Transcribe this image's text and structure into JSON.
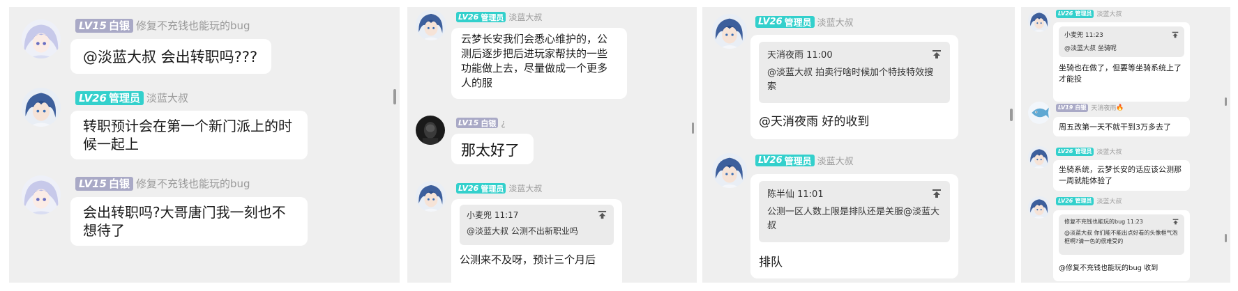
{
  "panels": {
    "p1": {
      "messages": [
        {
          "level": "LV15",
          "rank": "白银",
          "user": "修复不充钱也能玩的bug",
          "text": "@淡蓝大叔 会出转职吗???"
        },
        {
          "level": "LV26",
          "rank": "管理员",
          "user": "淡蓝大叔",
          "text": "转职预计会在第一个新门派上的时候一起上"
        },
        {
          "level": "LV15",
          "rank": "白银",
          "user": "修复不充钱也能玩的bug",
          "text": "会出转职吗?大哥唐门我一刻也不想待了"
        }
      ]
    },
    "p2": {
      "messages": [
        {
          "level": "LV26",
          "rank": "管理员",
          "user": "淡蓝大叔",
          "text": "云梦长安我们会悉心维护的，公测后逐步把后进玩家帮扶的一些功能做上去，尽量做成一个更多人的服"
        },
        {
          "level": "LV15",
          "rank": "白银",
          "user": "¿",
          "text": "那太好了"
        },
        {
          "level": "LV26",
          "rank": "管理员",
          "user": "淡蓝大叔",
          "quote_head": "小麦兜 11:17",
          "quote_body": "@淡蓝大叔 公测不出新职业吗",
          "text": "公测来不及呀，预计三个月后"
        }
      ]
    },
    "p3": {
      "messages": [
        {
          "level": "LV26",
          "rank": "管理员",
          "user": "淡蓝大叔",
          "quote_head": "天消夜雨 11:00",
          "quote_body": "@淡蓝大叔 拍卖行啥时候加个特技特效搜索",
          "text": "@天消夜雨 好的收到"
        },
        {
          "level": "LV26",
          "rank": "管理员",
          "user": "淡蓝大叔",
          "quote_head": "陈半仙 11:01",
          "quote_body": "公测一区人数上限是排队还是关服@淡蓝大叔",
          "text": "排队"
        }
      ]
    },
    "p4": {
      "messages": [
        {
          "level": "LV26",
          "rank": "管理员",
          "user": "淡蓝大叔",
          "quote_head": "小麦兜 11:23",
          "quote_body": "@淡蓝大叔 坐骑呢",
          "text": "坐骑也在做了，但要等坐骑系统上了才能投"
        },
        {
          "level": "LV19",
          "rank": "白银",
          "user": "天消夜雨",
          "fire": "🔥",
          "text": "周五改第一天不就干到3万多去了"
        },
        {
          "level": "LV26",
          "rank": "管理员",
          "user": "淡蓝大叔",
          "text": "坐骑系统，云梦长安的话应该公测那一周就能体验了"
        },
        {
          "level": "LV26",
          "rank": "管理员",
          "user": "淡蓝大叔",
          "quote_head": "修复不充钱也能玩的bug 11:23",
          "quote_body": "@淡蓝大叔 你们能不能出点好看的头像框气泡框啊?清一色的很难受的",
          "text": "@修复不充钱也能玩的bug 收到"
        }
      ]
    }
  },
  "icons": {
    "pin": "pin-top-icon",
    "fire": "fire-icon"
  },
  "colors": {
    "admin_badge": "#33d0cc",
    "silver_badge": "#a9a9c6",
    "panel_bg": "#efefef",
    "bubble_bg": "#ffffff",
    "quote_bg": "#ebebeb",
    "username": "#9a9a9a"
  }
}
